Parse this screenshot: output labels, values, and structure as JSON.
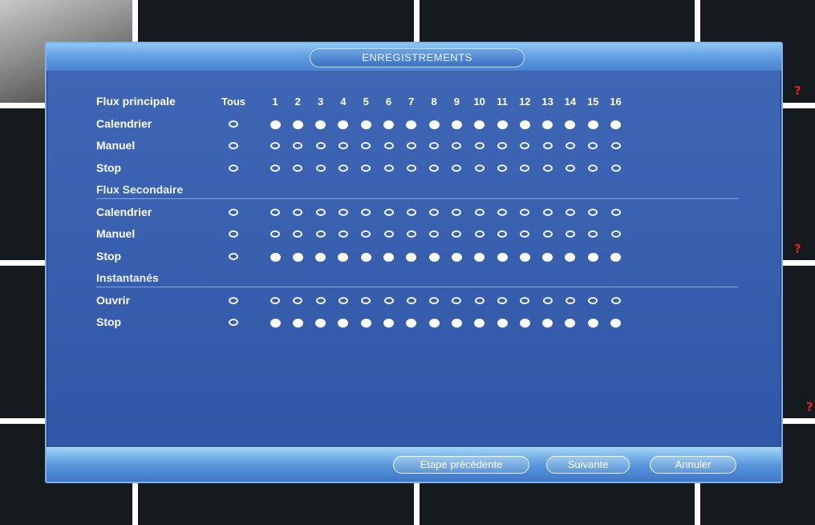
{
  "dialog": {
    "title": "ENREGISTREMENTS",
    "help_icon": "question-mark-icon",
    "help_text": "?"
  },
  "table": {
    "header": {
      "label": "Flux principale",
      "all_label": "Tous",
      "channels": [
        "1",
        "2",
        "3",
        "4",
        "5",
        "6",
        "7",
        "8",
        "9",
        "10",
        "11",
        "12",
        "13",
        "14",
        "15",
        "16"
      ]
    },
    "sections": [
      {
        "title": "",
        "rows": [
          {
            "label": "Calendrier",
            "all": false,
            "channels_selected": true
          },
          {
            "label": "Manuel",
            "all": false,
            "channels_selected": false
          },
          {
            "label": "Stop",
            "all": false,
            "channels_selected": false
          }
        ]
      },
      {
        "title": "Flux Secondaire",
        "rows": [
          {
            "label": "Calendrier",
            "all": false,
            "channels_selected": false
          },
          {
            "label": "Manuel",
            "all": false,
            "channels_selected": false
          },
          {
            "label": "Stop",
            "all": false,
            "channels_selected": true
          }
        ]
      },
      {
        "title": "Instantanés",
        "rows": [
          {
            "label": "Ouvrir",
            "all": false,
            "channels_selected": false
          },
          {
            "label": "Stop",
            "all": false,
            "channels_selected": true
          }
        ]
      }
    ]
  },
  "footer": {
    "prev_label": "Etape précédente",
    "next_label": "Suivante",
    "cancel_label": "Annuler"
  },
  "colors": {
    "panel": "#3a61b0",
    "title_bar": "#5d9ae0",
    "help_icon": "#e0241c"
  }
}
